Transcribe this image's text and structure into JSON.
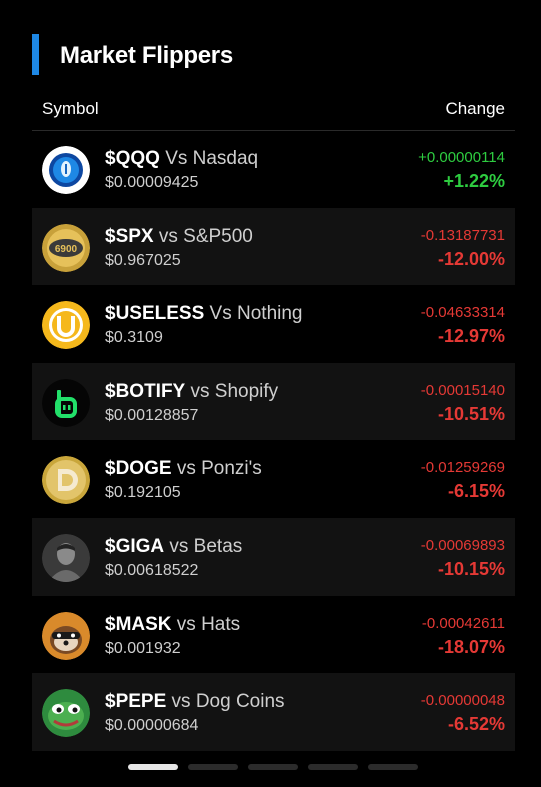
{
  "header": {
    "title": "Market Flippers"
  },
  "columns": {
    "symbol": "Symbol",
    "change": "Change"
  },
  "rows": [
    {
      "ticker": "$QQQ",
      "vs": "Vs Nasdaq",
      "price": "$0.00009425",
      "change_abs": "+0.00000114",
      "change_pct": "+1.22%",
      "direction": "up",
      "icon": "qqq-logo-icon"
    },
    {
      "ticker": "$SPX",
      "vs": "vs S&P500",
      "price": "$0.967025",
      "change_abs": "-0.13187731",
      "change_pct": "-12.00%",
      "direction": "down",
      "icon": "spx6900-coin-icon"
    },
    {
      "ticker": "$USELESS",
      "vs": "Vs Nothing",
      "price": "$0.3109",
      "change_abs": "-0.04633314",
      "change_pct": "-12.97%",
      "direction": "down",
      "icon": "useless-coin-icon"
    },
    {
      "ticker": "$BOTIFY",
      "vs": "vs Shopify",
      "price": "$0.00128857",
      "change_abs": "-0.00015140",
      "change_pct": "-10.51%",
      "direction": "down",
      "icon": "botify-logo-icon"
    },
    {
      "ticker": "$DOGE",
      "vs": "vs Ponzi's",
      "price": "$0.192105",
      "change_abs": "-0.01259269",
      "change_pct": "-6.15%",
      "direction": "down",
      "icon": "doge-coin-icon"
    },
    {
      "ticker": "$GIGA",
      "vs": "vs Betas",
      "price": "$0.00618522",
      "change_abs": "-0.00069893",
      "change_pct": "-10.15%",
      "direction": "down",
      "icon": "giga-avatar-icon"
    },
    {
      "ticker": "$MASK",
      "vs": "vs Hats",
      "price": "$0.001932",
      "change_abs": "-0.00042611",
      "change_pct": "-18.07%",
      "direction": "down",
      "icon": "mask-raccoon-icon"
    },
    {
      "ticker": "$PEPE",
      "vs": "vs Dog Coins",
      "price": "$0.00000684",
      "change_abs": "-0.00000048",
      "change_pct": "-6.52%",
      "direction": "down",
      "icon": "pepe-frog-icon"
    }
  ],
  "pager": {
    "count": 5,
    "active": 1
  },
  "colors": {
    "accent": "#1e88e5",
    "up": "#2ecc40",
    "down": "#e53935",
    "row_alt": "#121212"
  }
}
